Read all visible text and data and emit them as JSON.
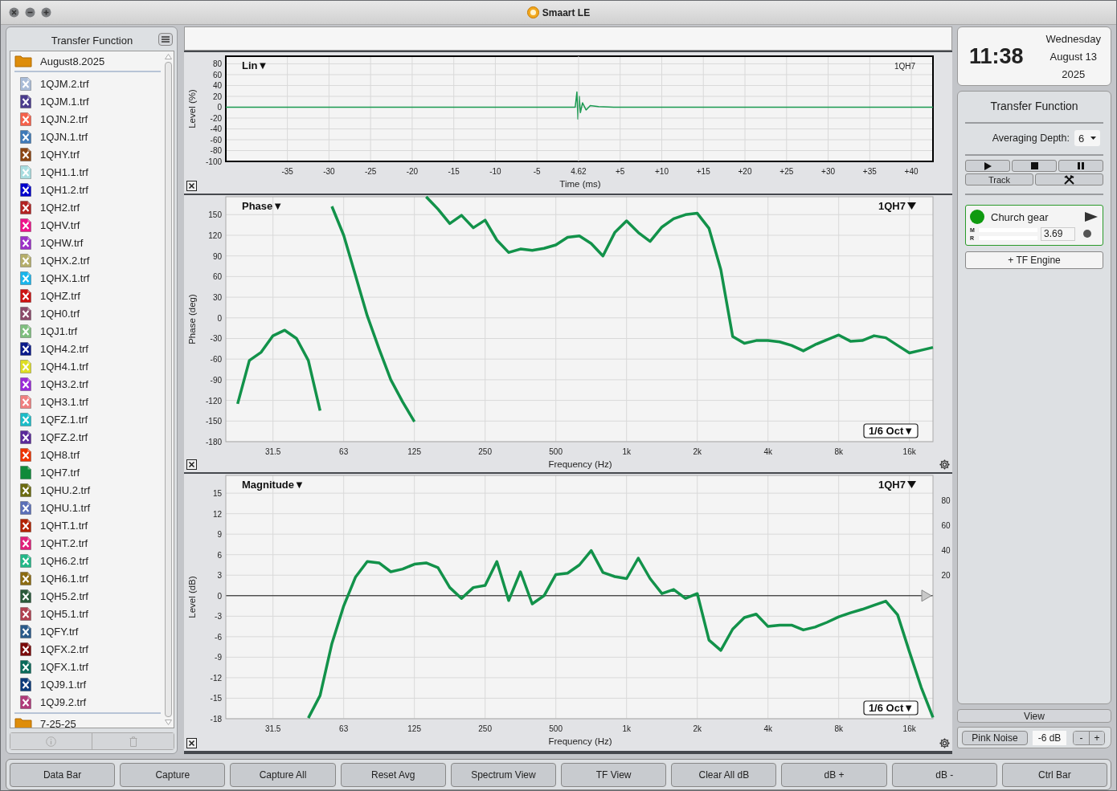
{
  "window": {
    "title": "Smaart LE"
  },
  "sidebar": {
    "title": "Transfer Function",
    "folders": [
      {
        "name": "August8.2025",
        "files": [
          {
            "name": "1QJM.2.trf",
            "color": "#a9bcd8",
            "shown": false
          },
          {
            "name": "1QJM.1.trf",
            "color": "#4a3b8c",
            "shown": false
          },
          {
            "name": "1QJN.2.trf",
            "color": "#f5604a",
            "shown": false
          },
          {
            "name": "1QJN.1.trf",
            "color": "#3f7ab8",
            "shown": false
          },
          {
            "name": "1QHY.trf",
            "color": "#8b4513",
            "shown": false
          },
          {
            "name": "1QH1.1.trf",
            "color": "#a8dde0",
            "shown": false
          },
          {
            "name": "1QH1.2.trf",
            "color": "#0000cc",
            "shown": false
          },
          {
            "name": "1QH2.trf",
            "color": "#b22222",
            "shown": false
          },
          {
            "name": "1QHV.trf",
            "color": "#ee1189",
            "shown": false
          },
          {
            "name": "1QHW.trf",
            "color": "#9b30c8",
            "shown": false
          },
          {
            "name": "1QHX.2.trf",
            "color": "#b5ae6a",
            "shown": false
          },
          {
            "name": "1QHX.1.trf",
            "color": "#19b5ec",
            "shown": false
          },
          {
            "name": "1QHZ.trf",
            "color": "#cc1111",
            "shown": false
          },
          {
            "name": "1QH0.trf",
            "color": "#8b4a6a",
            "shown": false
          },
          {
            "name": "1QJ1.trf",
            "color": "#7fbf7f",
            "shown": false
          },
          {
            "name": "1QH4.2.trf",
            "color": "#0a1a8a",
            "shown": false
          },
          {
            "name": "1QH4.1.trf",
            "color": "#dede22",
            "shown": false
          },
          {
            "name": "1QH3.2.trf",
            "color": "#9a2ad8",
            "shown": false
          },
          {
            "name": "1QH3.1.trf",
            "color": "#f08080",
            "shown": false
          },
          {
            "name": "1QFZ.1.trf",
            "color": "#1bbdc8",
            "shown": false
          },
          {
            "name": "1QFZ.2.trf",
            "color": "#5a2a9a",
            "shown": false
          },
          {
            "name": "1QH8.trf",
            "color": "#ee3300",
            "shown": false
          },
          {
            "name": "1QH7.trf",
            "color": "#0f8a3a",
            "shown": true
          },
          {
            "name": "1QHU.2.trf",
            "color": "#6b6b10",
            "shown": false
          },
          {
            "name": "1QHU.1.trf",
            "color": "#5a6fb8",
            "shown": false
          },
          {
            "name": "1QHT.1.trf",
            "color": "#b22200",
            "shown": false
          },
          {
            "name": "1QHT.2.trf",
            "color": "#e0207a",
            "shown": false
          },
          {
            "name": "1QH6.2.trf",
            "color": "#22b888",
            "shown": false
          },
          {
            "name": "1QH6.1.trf",
            "color": "#8b6a10",
            "shown": false
          },
          {
            "name": "1QH5.2.trf",
            "color": "#2a5a3a",
            "shown": false
          },
          {
            "name": "1QH5.1.trf",
            "color": "#b04050",
            "shown": false
          },
          {
            "name": "1QFY.trf",
            "color": "#2a5a8a",
            "shown": false
          },
          {
            "name": "1QFX.2.trf",
            "color": "#7a0a0a",
            "shown": false
          },
          {
            "name": "1QFX.1.trf",
            "color": "#0a6a5a",
            "shown": false
          },
          {
            "name": "1QJ9.1.trf",
            "color": "#0a3a7a",
            "shown": false
          },
          {
            "name": "1QJ9.2.trf",
            "color": "#b03a7a",
            "shown": false
          }
        ]
      },
      {
        "name": "7-25-25"
      }
    ]
  },
  "impulse": {
    "mode": "Lin▼",
    "trace_dropdown": false,
    "center_label": "4.62",
    "chart_data": {
      "type": "line",
      "xlabel": "Time (ms)",
      "ylabel": "Level (%)",
      "xlim": [
        -42.4,
        42.6
      ],
      "ylim": [
        -100,
        94
      ],
      "grid": true,
      "xticks": [
        -35,
        -30,
        -25,
        -20,
        -15,
        -10,
        -5,
        {
          "value": 5,
          "label": "+5"
        },
        {
          "value": 10,
          "label": "+10"
        },
        {
          "value": 15,
          "label": "+15"
        },
        {
          "value": 20,
          "label": "+20"
        },
        {
          "value": 25,
          "label": "+25"
        },
        {
          "value": 30,
          "label": "+30"
        },
        {
          "value": 35,
          "label": "+35"
        },
        {
          "value": 40,
          "label": "+40"
        }
      ],
      "yticks": [
        80,
        60,
        40,
        20,
        0,
        -20,
        -40,
        -60,
        -80,
        -100
      ],
      "x": [
        -42.4,
        -35,
        -25,
        -15,
        -5,
        -0.4,
        -0.2,
        -0.07,
        0.08,
        0.23,
        0.48,
        0.9,
        1.4,
        2.4,
        4.4,
        15,
        42.6
      ],
      "series": [
        {
          "name": "1QH7",
          "color": "#1a9a50",
          "values": [
            0,
            0,
            0,
            0,
            0,
            0,
            28,
            -22,
            20,
            -10,
            8,
            -5,
            3,
            1,
            0,
            0,
            0
          ]
        }
      ]
    }
  },
  "phase": {
    "mode": "Phase▼",
    "trace_dropdown": true,
    "smoothing": "1/6 Oct▼",
    "chart_data": {
      "type": "line",
      "xlabel": "Frequency (Hz)",
      "ylabel": "Phase (deg)",
      "ylim": [
        -180,
        176
      ],
      "grid": true,
      "categories": [
        null,
        null,
        null,
        null,
        "31.5",
        null,
        null,
        null,
        null,
        null,
        "63",
        null,
        null,
        null,
        null,
        null,
        "125",
        null,
        null,
        null,
        null,
        null,
        "250",
        null,
        null,
        null,
        null,
        null,
        "500",
        null,
        null,
        null,
        null,
        null,
        "1k",
        null,
        null,
        null,
        null,
        null,
        "2k",
        null,
        null,
        null,
        null,
        null,
        "4k",
        null,
        null,
        null,
        null,
        null,
        "8k",
        null,
        null,
        null,
        null,
        null,
        "16k",
        null,
        null
      ],
      "yticks": [
        150,
        120,
        90,
        60,
        30,
        0,
        -30,
        -60,
        -90,
        -120,
        -150,
        -180
      ],
      "series": [
        {
          "name": "1QH7",
          "color": "#12924a",
          "values": [
            null,
            -125,
            -62,
            -50,
            -26,
            -18,
            -30,
            -62,
            -135,
            162,
            120,
            62,
            3,
            -45,
            -90,
            -122,
            -151,
            176,
            158,
            137,
            149,
            131,
            142,
            113,
            95,
            100,
            98,
            101,
            106,
            117,
            119,
            108,
            90,
            124,
            141,
            124,
            111,
            132,
            144,
            150,
            152,
            130,
            70,
            -27,
            -37,
            -33,
            -33,
            -35,
            -40,
            -48,
            -39,
            -32,
            -25,
            -34,
            -33,
            -26,
            -29,
            -40,
            -51,
            -47,
            -43
          ]
        }
      ]
    }
  },
  "magnitude": {
    "mode": "Magnitude▼",
    "trace_dropdown": true,
    "smoothing": "1/6 Oct▼",
    "coherence_ticks": [
      "80",
      "60",
      "40",
      "20"
    ],
    "chart_data": {
      "type": "line",
      "xlabel": "Frequency (Hz)",
      "ylabel": "Level (dB)",
      "ylim": [
        -18,
        17.6
      ],
      "grid": true,
      "categories": [
        null,
        null,
        null,
        null,
        "31.5",
        null,
        null,
        null,
        null,
        null,
        "63",
        null,
        null,
        null,
        null,
        null,
        "125",
        null,
        null,
        null,
        null,
        null,
        "250",
        null,
        null,
        null,
        null,
        null,
        "500",
        null,
        null,
        null,
        null,
        null,
        "1k",
        null,
        null,
        null,
        null,
        null,
        "2k",
        null,
        null,
        null,
        null,
        null,
        "4k",
        null,
        null,
        null,
        null,
        null,
        "8k",
        null,
        null,
        null,
        null,
        null,
        "16k",
        null,
        null
      ],
      "yticks": [
        15,
        12,
        9,
        6,
        3,
        0,
        -3,
        -6,
        -9,
        -12,
        -15,
        -18
      ],
      "series": [
        {
          "name": "1QH7",
          "color": "#12924a",
          "values": [
            null,
            null,
            null,
            null,
            null,
            null,
            null,
            -17.9,
            -14.6,
            -7,
            -1.5,
            2.7,
            5,
            4.8,
            3.5,
            3.9,
            4.6,
            4.8,
            4.1,
            1.2,
            -0.4,
            1.2,
            1.5,
            5,
            -0.7,
            3.5,
            -1.2,
            0,
            3.1,
            3.3,
            4.5,
            6.6,
            3.4,
            2.8,
            2.5,
            5.5,
            2.5,
            0.3,
            0.9,
            -0.4,
            0.3,
            -6.5,
            -8,
            -4.9,
            -3.2,
            -2.7,
            -4.5,
            -4.3,
            -4.3,
            -5,
            -4.6,
            -3.9,
            -3.1,
            -2.5,
            -2,
            -1.4,
            -0.8,
            -2.8,
            -8.2,
            -13.4,
            -17.8
          ]
        }
      ]
    }
  },
  "clock": {
    "time": "11:38",
    "weekday": "Wednesday",
    "date": "August 13",
    "year": "2025"
  },
  "control_panel": {
    "title": "Transfer Function",
    "averaging_label": "Averaging Depth:",
    "averaging_value": "6",
    "track_button": "Track",
    "engine": {
      "name": "Church gear",
      "running": true,
      "meter_labels": [
        "M",
        "R"
      ],
      "delay": "3.69"
    },
    "add_engine_button": "+ TF Engine",
    "view_button": "View",
    "generator": {
      "button": "Pink Noise",
      "level": "-6 dB",
      "minus": "-",
      "plus": "+"
    }
  },
  "toolbar": [
    "Data Bar",
    "Capture",
    "Capture All",
    "Reset Avg",
    "Spectrum View",
    "TF View",
    "Clear All dB",
    "dB +",
    "dB -",
    "Ctrl Bar"
  ]
}
